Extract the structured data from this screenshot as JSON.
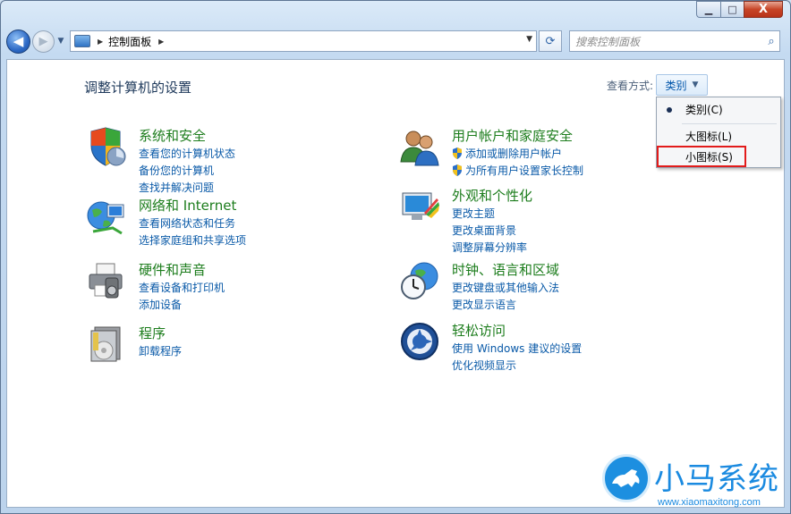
{
  "window": {
    "caption": {
      "minimize": "▁",
      "maximize": "□",
      "close": "X"
    }
  },
  "nav": {
    "back_glyph": "◀",
    "forward_glyph": "▶",
    "address": "控制面板",
    "search_placeholder": "搜索控制面板"
  },
  "main": {
    "title": "调整计算机的设置",
    "view_by_label": "查看方式:",
    "view_by_value": "类别"
  },
  "categories": [
    {
      "id": "system",
      "title": "系统和安全",
      "links": [
        "查看您的计算机状态",
        "备份您的计算机",
        "查找并解决问题"
      ]
    },
    {
      "id": "network",
      "title": "网络和 Internet",
      "links": [
        "查看网络状态和任务",
        "选择家庭组和共享选项"
      ]
    },
    {
      "id": "hardware",
      "title": "硬件和声音",
      "links": [
        "查看设备和打印机",
        "添加设备"
      ]
    },
    {
      "id": "programs",
      "title": "程序",
      "links": [
        "卸载程序"
      ]
    },
    {
      "id": "users",
      "title": "用户帐户和家庭安全",
      "links": [
        "添加或删除用户帐户",
        "为所有用户设置家长控制"
      ]
    },
    {
      "id": "appearance",
      "title": "外观和个性化",
      "links": [
        "更改主题",
        "更改桌面背景",
        "调整屏幕分辨率"
      ]
    },
    {
      "id": "clock",
      "title": "时钟、语言和区域",
      "links": [
        "更改键盘或其他输入法",
        "更改显示语言"
      ]
    },
    {
      "id": "access",
      "title": "轻松访问",
      "links": [
        "使用 Windows 建议的设置",
        "优化视频显示"
      ]
    }
  ],
  "menu": {
    "items": [
      "类别(C)",
      "大图标(L)",
      "小图标(S)"
    ],
    "selected": "类别(C)",
    "highlight_color": "#e21b1b"
  },
  "watermark": {
    "title": "小马系统",
    "url": "www.xiaomaxitong.com"
  }
}
